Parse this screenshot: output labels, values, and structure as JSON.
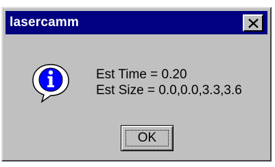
{
  "window": {
    "title": "lasercamm",
    "title_bar_color": "#000080",
    "face_color": "#c0c0c0"
  },
  "title_bar": {
    "close_icon": "close-icon",
    "close_glyph": "×"
  },
  "message": {
    "icon": "information-icon",
    "lines": [
      "Est Time = 0.20",
      "Est Size = 0.0,0.0,3.3,3.6"
    ]
  },
  "buttons": {
    "ok_label": "OK"
  }
}
